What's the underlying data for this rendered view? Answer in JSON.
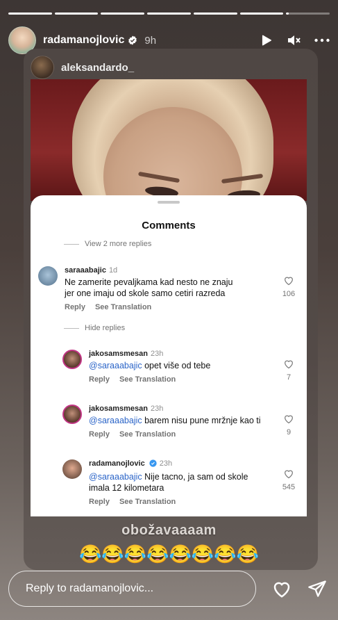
{
  "progress": [
    1,
    1,
    1,
    1,
    1,
    1,
    0.06
  ],
  "header": {
    "username": "radamanojlovic",
    "time": "9h"
  },
  "repost": {
    "username": "aleksandardo_"
  },
  "comments_sheet": {
    "title": "Comments",
    "view_more": "View 2 more replies",
    "hide_replies": "Hide replies",
    "comments": [
      {
        "username": "saraaabajic",
        "time": "1d",
        "mention": "",
        "text": "Ne zamerite pevaljkama kad nesto ne znaju jer one imaju od skole samo cetiri razreda",
        "reply": "Reply",
        "see_translation": "See Translation",
        "likes": "106"
      },
      {
        "username": "jakosamsmesan",
        "time": "23h",
        "mention": "@saraaabajic",
        "text": "opet više od tebe",
        "reply": "Reply",
        "see_translation": "See Translation",
        "likes": "7"
      },
      {
        "username": "jakosamsmesan",
        "time": "23h",
        "mention": "@saraaabajic",
        "text": "barem nisu pune mržnje kao ti",
        "reply": "Reply",
        "see_translation": "See Translation",
        "likes": "9"
      },
      {
        "username": "radamanojlovic",
        "time": "23h",
        "mention": "@saraaabajic",
        "text": "Nije tacno, ja sam od skole imala 12 kilometara",
        "reply": "Reply",
        "see_translation": "See Translation",
        "likes": "545"
      }
    ]
  },
  "caption": "obožavaaaam",
  "emojis": "😂😂😂😂😂😂😂😂",
  "reply_bar": {
    "placeholder": "Reply to radamanojlovic..."
  },
  "icons": {
    "play": "play-icon",
    "mute": "mute-icon",
    "more": "more-icon",
    "heart": "heart-icon",
    "send": "send-icon",
    "verified": "verified-badge-icon"
  },
  "colors": {
    "mention": "#2a64c8",
    "verified": "#3897f0"
  }
}
